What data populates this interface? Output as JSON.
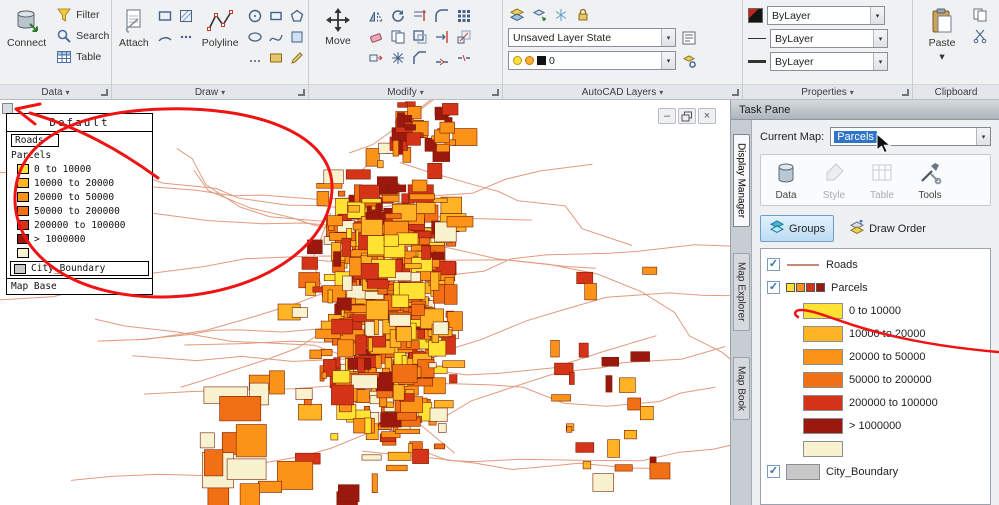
{
  "icons": {
    "dropdown": "▾",
    "check": "✓",
    "minimize": "–",
    "close": "×"
  },
  "ribbon": {
    "panels": {
      "data": {
        "label": "Data",
        "connect": "Connect",
        "filter": "Filter",
        "search": "Search",
        "table": "Table"
      },
      "draw": {
        "label": "Draw",
        "attach": "Attach",
        "polyline": "Polyline"
      },
      "modify": {
        "label": "Modify",
        "move": "Move"
      },
      "layers": {
        "label": "AutoCAD Layers",
        "layer_state": "Unsaved Layer State",
        "current_layer": "0"
      },
      "properties": {
        "label": "Properties",
        "color": "ByLayer",
        "linetype": "ByLayer",
        "lineweight": "ByLayer"
      },
      "clipboard": {
        "label": "Clipboard",
        "paste": "Paste"
      }
    }
  },
  "legend": {
    "title": "Default",
    "roads_label": "Roads",
    "parcels_label": "Parcels",
    "city_boundary_label": "City_Boundary",
    "map_base_label": "Map Base",
    "city_boundary_color": "#c8c8c8"
  },
  "legend_entries": [
    {
      "label": "0 to 10000",
      "color": "#ffe232"
    },
    {
      "label": "10000 to 20000",
      "color": "#ffb425"
    },
    {
      "label": "20000 to 50000",
      "color": "#fb9318"
    },
    {
      "label": "50000 to 200000",
      "color": "#f27014"
    },
    {
      "label": "200000 to 100000",
      "color": "#d53418"
    },
    {
      "label": "> 1000000",
      "color": "#9b180f"
    },
    {
      "label": "",
      "color": "#f9f2cf"
    }
  ],
  "taskpane": {
    "title": "Task Pane",
    "current_map_label": "Current Map:",
    "current_map_value": "Parcels",
    "tabs": [
      {
        "label": "Display Manager"
      },
      {
        "label": "Map Explorer"
      },
      {
        "label": "Map Book"
      }
    ],
    "toolbar": [
      {
        "label": "Data"
      },
      {
        "label": "Style"
      },
      {
        "label": "Table"
      },
      {
        "label": "Tools"
      }
    ],
    "groups_button": "Groups",
    "draw_order_button": "Draw Order",
    "tree": {
      "roads": "Roads",
      "parcels": "Parcels",
      "city_boundary": "City_Boundary"
    }
  },
  "map": {
    "road_color": "#e29a7e",
    "outline_color": "#7a1d00",
    "annotation_color": "#ee1414"
  }
}
